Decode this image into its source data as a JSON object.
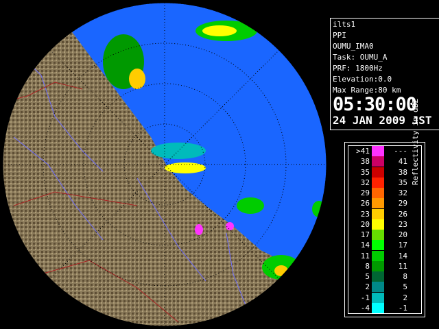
{
  "site": "ilts1",
  "product": "PPI",
  "station": "OUMU_IMA0",
  "task": "Task: OUMU_A",
  "prf": "PRF: 1800Hz",
  "elevation": "Elevation:0.0",
  "max_range": "Max Range:80 km",
  "time": "05:30:00",
  "date": "24 JAN 2009 JST",
  "legend": {
    "unit": "Reflectivity in dBZ",
    "rows": [
      {
        "lo": ">41",
        "hi": "---",
        "color": "#ff33ff"
      },
      {
        "lo": "38",
        "hi": "41",
        "color": "#cc0066"
      },
      {
        "lo": "35",
        "hi": "38",
        "color": "#cc0000"
      },
      {
        "lo": "32",
        "hi": "35",
        "color": "#ff2200"
      },
      {
        "lo": "29",
        "hi": "32",
        "color": "#ff6600"
      },
      {
        "lo": "26",
        "hi": "29",
        "color": "#ff9900"
      },
      {
        "lo": "23",
        "hi": "26",
        "color": "#ffcc00"
      },
      {
        "lo": "20",
        "hi": "23",
        "color": "#ffff00"
      },
      {
        "lo": "17",
        "hi": "20",
        "color": "#66dd00"
      },
      {
        "lo": "14",
        "hi": "17",
        "color": "#00ff00"
      },
      {
        "lo": "11",
        "hi": "14",
        "color": "#00cc00"
      },
      {
        "lo": "8",
        "hi": "11",
        "color": "#009900"
      },
      {
        "lo": "5",
        "hi": "8",
        "color": "#006633"
      },
      {
        "lo": "2",
        "hi": "5",
        "color": "#008888"
      },
      {
        "lo": "-1",
        "hi": "2",
        "color": "#00bbbb"
      },
      {
        "lo": "-4",
        "hi": "-1",
        "color": "#00ffff"
      }
    ]
  },
  "map_colors": {
    "sea": "#1a66ff",
    "outside": "#000000",
    "land": "#8a7a5a",
    "rivers": "#6f6fff",
    "borders": "#aa2222",
    "range_rings": "#000000"
  }
}
